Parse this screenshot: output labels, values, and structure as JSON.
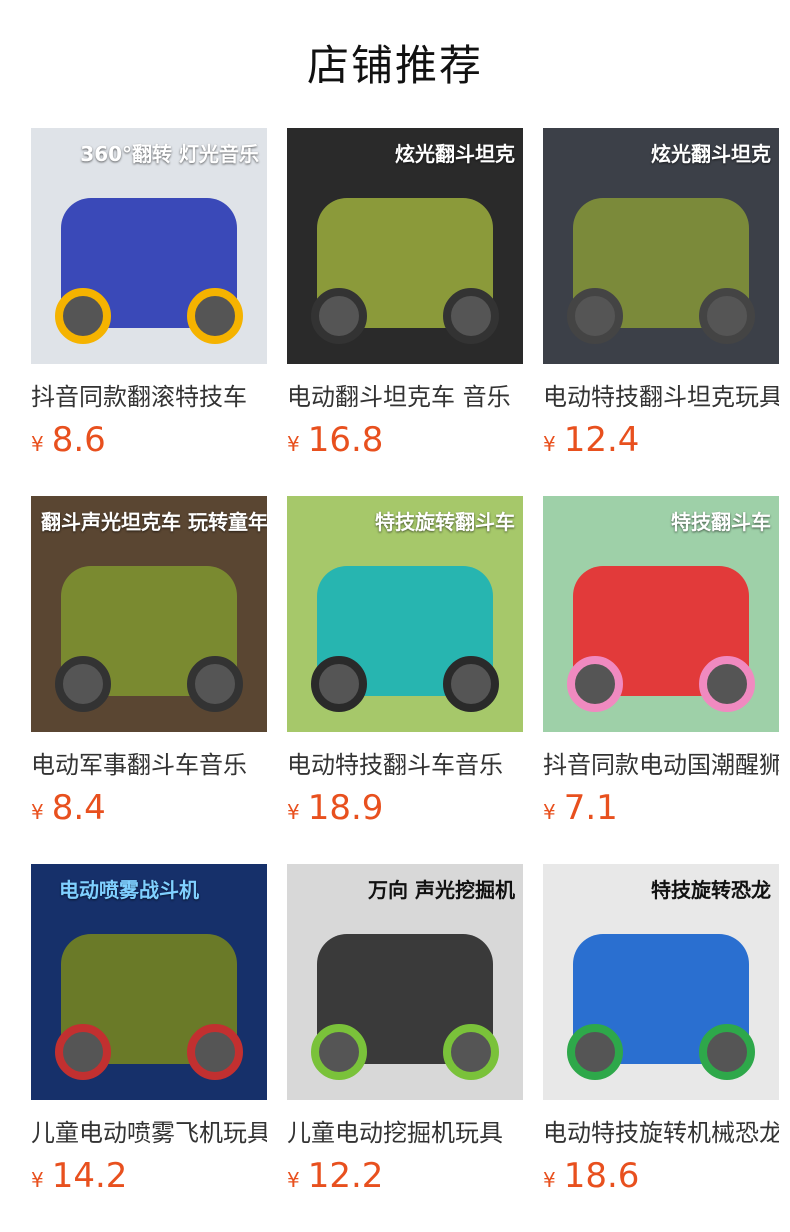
{
  "page": {
    "title": "店铺推荐"
  },
  "products": [
    {
      "name": "抖音同款翻滚特技车",
      "currency": "¥",
      "price": "8.6",
      "image_text": "360°翻转 灯光音乐",
      "bg": "#dfe3e8",
      "toy": "#3a49b8",
      "wheel": "#f5b300"
    },
    {
      "name": "电动翻斗坦克车 音乐",
      "currency": "¥",
      "price": "16.8",
      "image_text": "炫光翻斗坦克",
      "bg": "#2a2a2a",
      "toy": "#8b9a3a",
      "wheel": "#333333"
    },
    {
      "name": "电动特技翻斗坦克玩具",
      "currency": "¥",
      "price": "12.4",
      "image_text": "炫光翻斗坦克",
      "bg": "#3c4048",
      "toy": "#7b8a3a",
      "wheel": "#444444"
    },
    {
      "name": "电动军事翻斗车音乐",
      "currency": "¥",
      "price": "8.4",
      "image_text": "翻斗声光坦克车 玩转童年!",
      "bg": "#5a4632",
      "toy": "#7a8a30",
      "wheel": "#333333"
    },
    {
      "name": "电动特技翻斗车音乐",
      "currency": "¥",
      "price": "18.9",
      "image_text": "特技旋转翻斗车",
      "bg": "#a6c86a",
      "toy": "#27b5b0",
      "wheel": "#2a2a2a"
    },
    {
      "name": "抖音同款电动国潮醒狮",
      "currency": "¥",
      "price": "7.1",
      "image_text": "特技翻斗车",
      "bg": "#9ed0a8",
      "toy": "#e23a3a",
      "wheel": "#f08ac0"
    },
    {
      "name": "儿童电动喷雾飞机玩具",
      "currency": "¥",
      "price": "14.2",
      "image_text": "电动喷雾战斗机",
      "bg": "#16306a",
      "toy": "#6a7a28",
      "wheel": "#c23030"
    },
    {
      "name": "儿童电动挖掘机玩具",
      "currency": "¥",
      "price": "12.2",
      "image_text": "万向 声光挖掘机",
      "bg": "#d8d8d8",
      "toy": "#3a3a3a",
      "wheel": "#7ac23a"
    },
    {
      "name": "电动特技旋转机械恐龙",
      "currency": "¥",
      "price": "18.6",
      "image_text": "特技旋转恐龙",
      "bg": "#e8e8e8",
      "toy": "#2a6fd0",
      "wheel": "#2ea84a"
    }
  ]
}
